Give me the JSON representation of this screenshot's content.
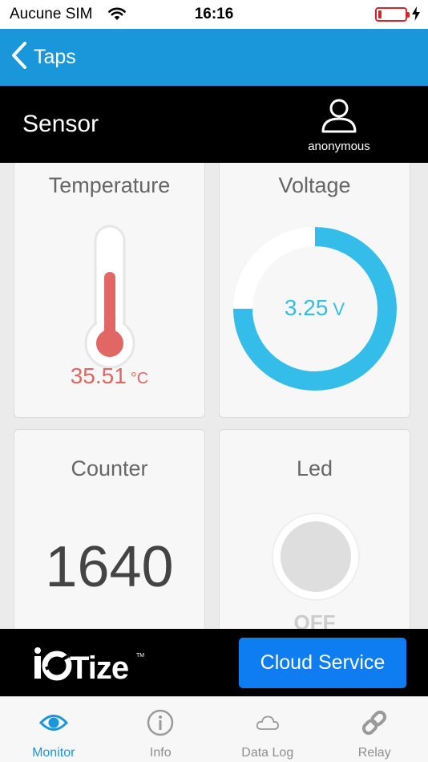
{
  "status_bar": {
    "carrier": "Aucune SIM",
    "time": "16:16"
  },
  "nav": {
    "back_label": "Taps"
  },
  "header": {
    "title": "Sensor",
    "user": "anonymous"
  },
  "cards": {
    "temperature": {
      "title": "Temperature",
      "value": "35.51",
      "unit": "°C",
      "level_fraction": 0.65
    },
    "voltage": {
      "title": "Voltage",
      "value": "3.25",
      "unit": "V",
      "gauge_fraction": 0.75
    },
    "counter": {
      "title": "Counter",
      "value": "1640"
    },
    "led": {
      "title": "Led",
      "state": "OFF"
    }
  },
  "banner": {
    "cloud_button": "Cloud Service",
    "logo_text": "IOTize",
    "logo_tm": "TM"
  },
  "tabs": [
    {
      "label": "Monitor",
      "icon": "eye-icon",
      "active": true
    },
    {
      "label": "Info",
      "icon": "info-icon",
      "active": false
    },
    {
      "label": "Data Log",
      "icon": "cloud-icon",
      "active": false
    },
    {
      "label": "Relay",
      "icon": "link-icon",
      "active": false
    }
  ],
  "colors": {
    "nav_blue": "#1a96db",
    "button_blue": "#0f7df2",
    "temperature_red": "#e06763",
    "voltage_cyan": "#35bde9",
    "battery_red": "#d8242b"
  }
}
